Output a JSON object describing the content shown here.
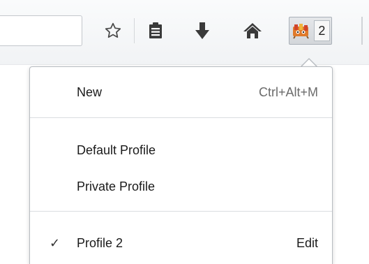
{
  "toolbar": {
    "icons": {
      "bookmark": "star-outline",
      "reader": "clipboard-list",
      "download": "arrow-down",
      "home": "house",
      "profile": "profile-avatar"
    },
    "profile_count": "2"
  },
  "menu": {
    "new_item": {
      "label": "New",
      "shortcut": "Ctrl+Alt+M"
    },
    "profiles": [
      {
        "label": "Default Profile"
      },
      {
        "label": "Private Profile"
      }
    ],
    "current_profile": {
      "check": "✓",
      "label": "Profile 2",
      "edit_label": "Edit"
    }
  }
}
